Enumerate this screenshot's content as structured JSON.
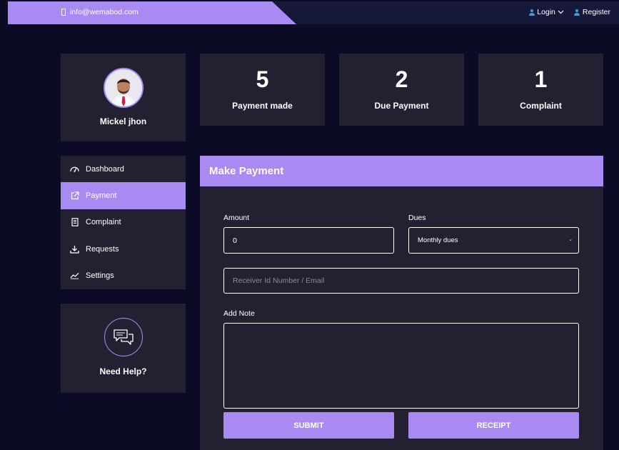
{
  "topbar": {
    "email": "info@wemabod.com",
    "login_label": "Login",
    "register_label": "Register"
  },
  "profile": {
    "name": "Mickel jhon"
  },
  "stats": [
    {
      "value": "5",
      "label": "Payment made"
    },
    {
      "value": "2",
      "label": "Due Payment"
    },
    {
      "value": "1",
      "label": "Complaint"
    }
  ],
  "sidebar": {
    "items": [
      {
        "label": "Dashboard",
        "icon": "gauge-icon",
        "active": false
      },
      {
        "label": "Payment",
        "icon": "external-link-icon",
        "active": true
      },
      {
        "label": "Complaint",
        "icon": "document-icon",
        "active": false
      },
      {
        "label": "Requests",
        "icon": "download-icon",
        "active": false
      },
      {
        "label": "Settings",
        "icon": "trend-line-icon",
        "active": false
      }
    ]
  },
  "help": {
    "title": "Need Help?",
    "icon": "chat-bubbles-icon"
  },
  "payment_form": {
    "title": "Make Payment",
    "amount_label": "Amount",
    "amount_value": "0",
    "dues_label": "Dues",
    "dues_selected": "Monthly dues",
    "receiver_placeholder": "Receiver Id Number / Email",
    "note_label": "Add Note",
    "note_value": "",
    "submit_label": "SUBMIT",
    "receipt_label": "RECEIPT"
  },
  "colors": {
    "accent": "#a98af2",
    "background": "#0b0b25",
    "card": "#232131",
    "topbar": "#16183a",
    "user_icon": "#3aa0d6"
  }
}
